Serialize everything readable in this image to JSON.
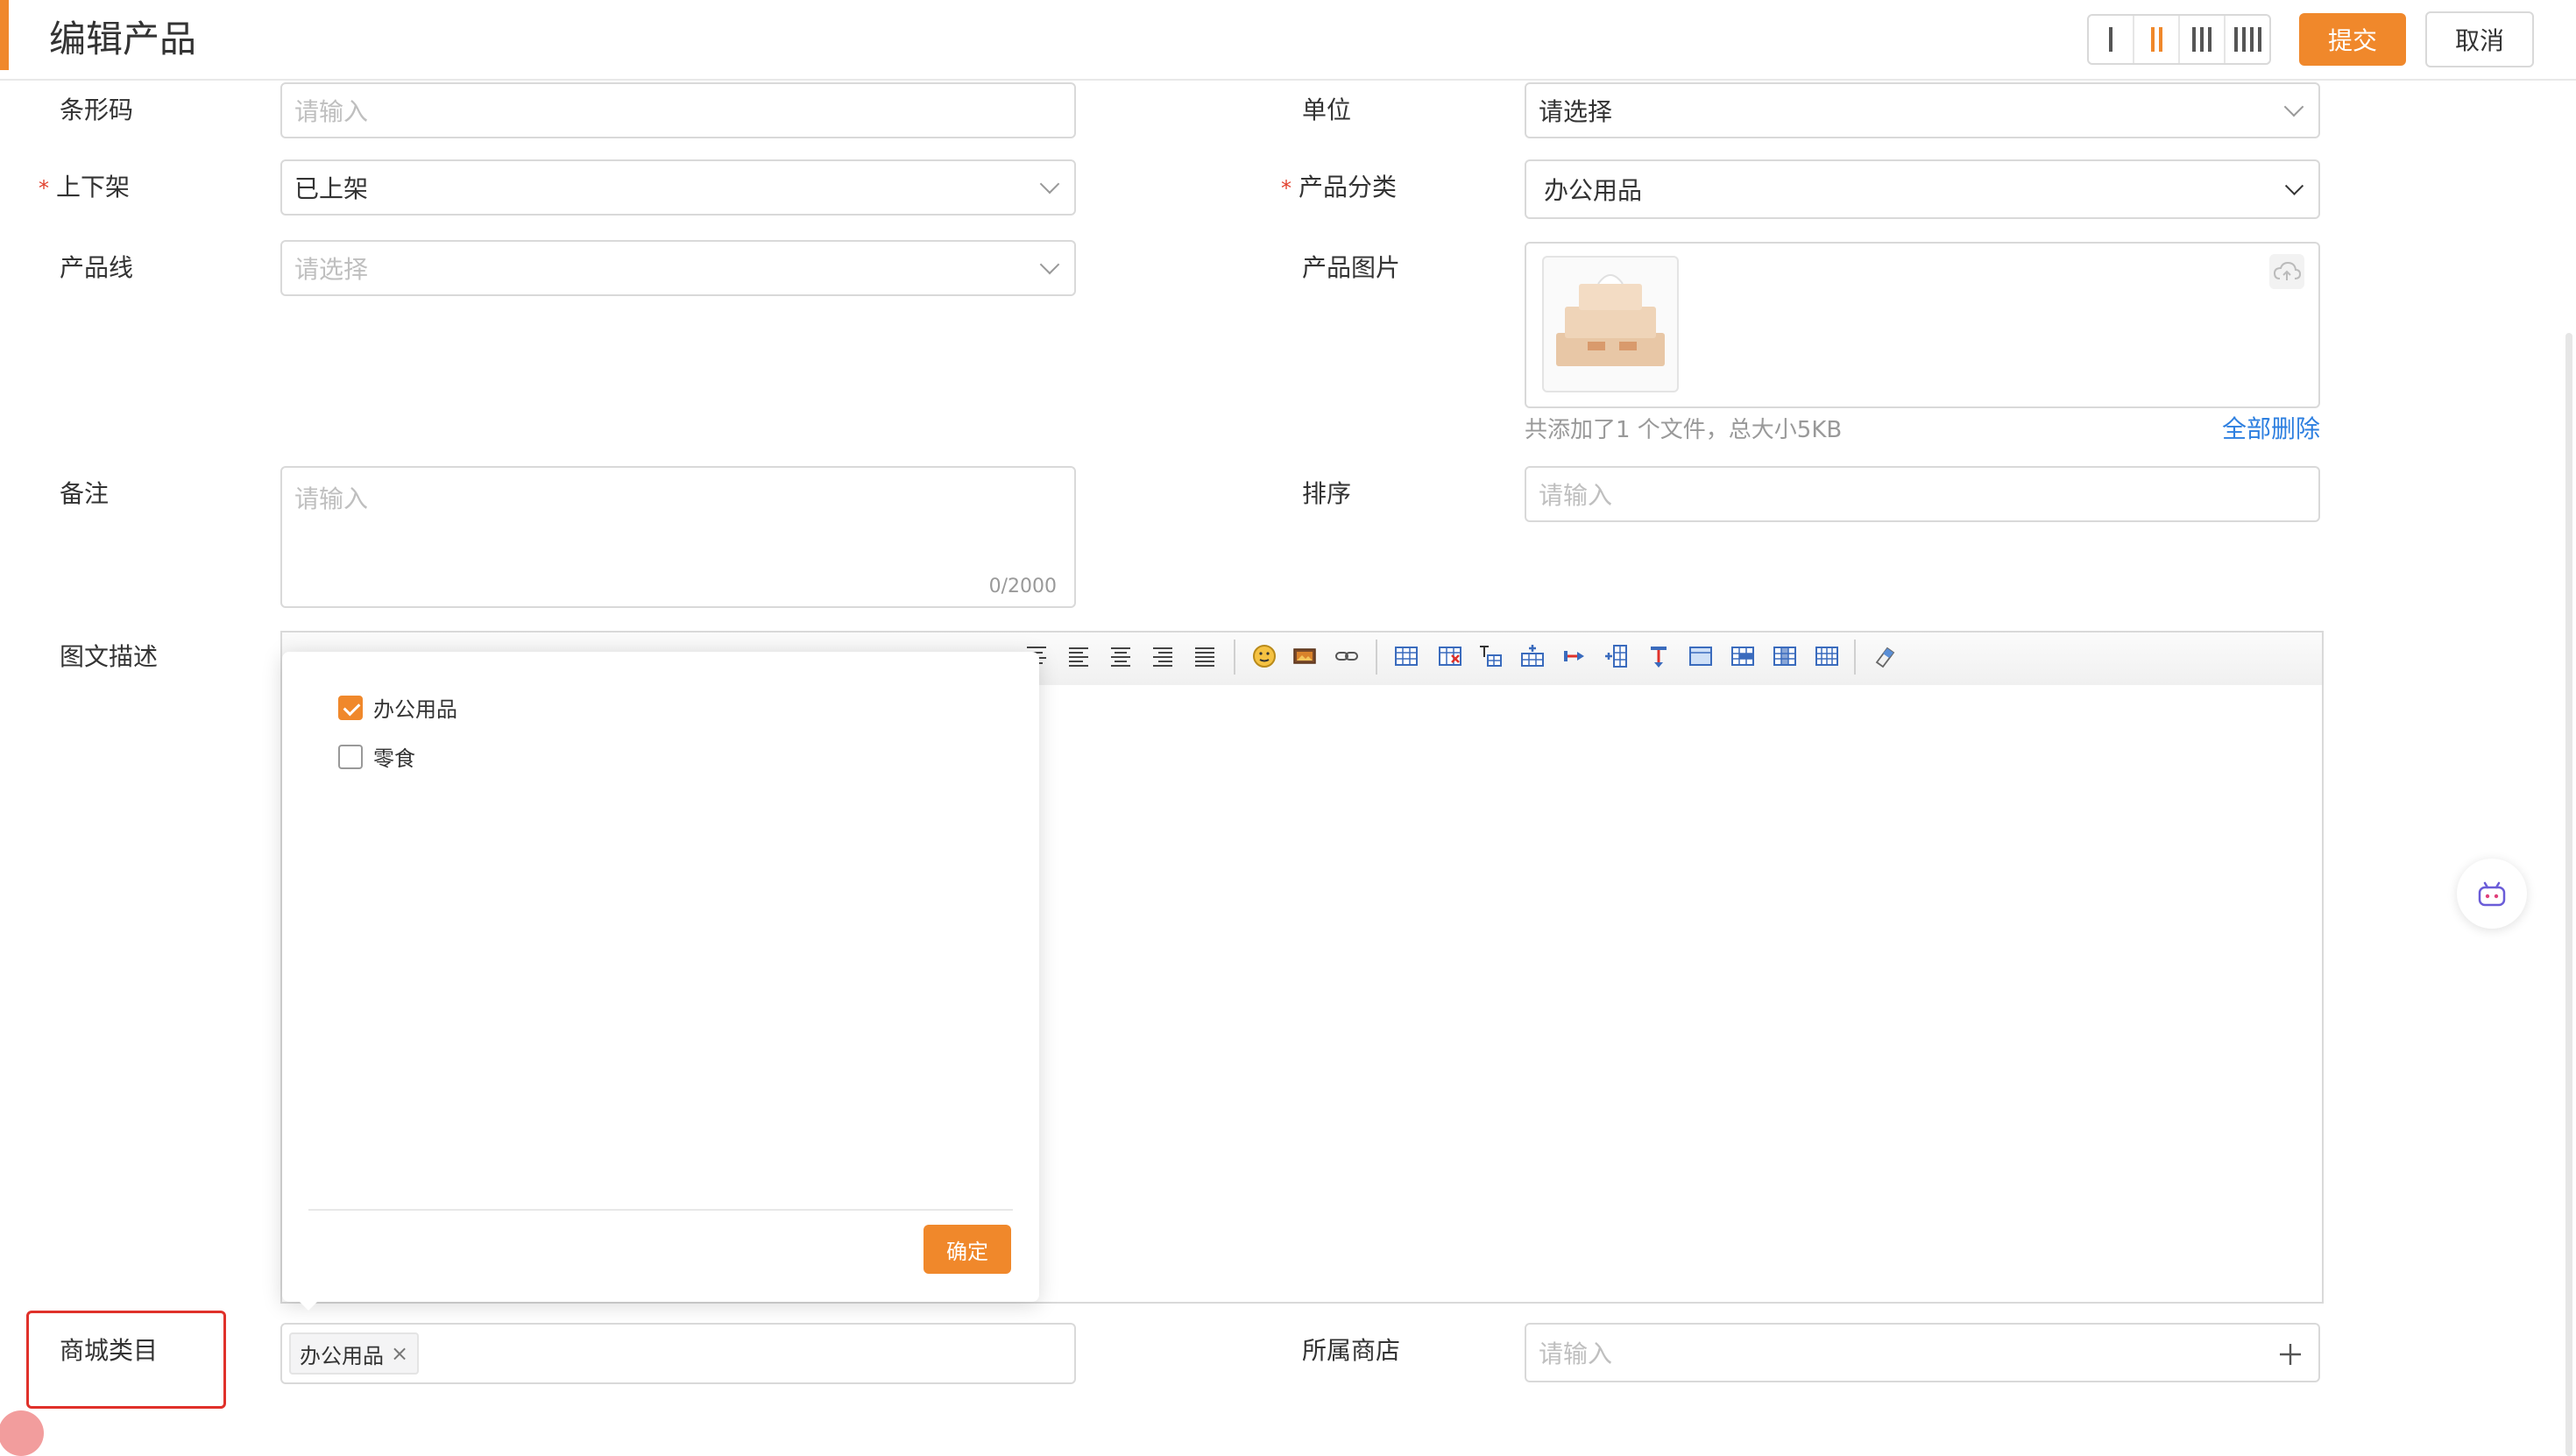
{
  "header": {
    "title": "编辑产品",
    "submit_label": "提交",
    "cancel_label": "取消",
    "layout_options": [
      "1-column",
      "2-column",
      "3-column",
      "4-column"
    ],
    "layout_selected": "2-column",
    "accent_color": "#f0882b"
  },
  "form": {
    "barcode": {
      "label": "条形码",
      "placeholder": "请输入"
    },
    "unit": {
      "label": "单位",
      "value": "请选择"
    },
    "shelf": {
      "label": "上下架",
      "value": "已上架",
      "required": true
    },
    "category": {
      "label": "产品分类",
      "value": "办公用品",
      "required": true
    },
    "product_line": {
      "label": "产品线",
      "placeholder": "请选择"
    },
    "image": {
      "label": "产品图片",
      "summary": "共添加了1 个文件，总大小5KB",
      "delete_all": "全部删除"
    },
    "remark": {
      "label": "备注",
      "placeholder": "请输入",
      "counter": "0/2000"
    },
    "sort": {
      "label": "排序",
      "placeholder": "请输入"
    },
    "description": {
      "label": "图文描述"
    },
    "mall_category": {
      "label": "商城类目",
      "tags": [
        "办公用品"
      ]
    },
    "shop": {
      "label": "所属商店",
      "placeholder": "请输入"
    }
  },
  "dropdown": {
    "options": [
      {
        "label": "办公用品",
        "checked": true
      },
      {
        "label": "零食",
        "checked": false
      }
    ],
    "confirm_label": "确定"
  },
  "toolbar_icons": [
    "align-top-icon",
    "align-left-icon",
    "align-center-icon",
    "align-right-icon",
    "align-justify-icon",
    "emoticon-icon",
    "image-icon",
    "link-icon",
    "insert-table-icon",
    "delete-table-icon",
    "table-caption-icon",
    "insert-row-icon",
    "delete-row-icon",
    "insert-column-icon",
    "delete-column-icon",
    "merge-cells-icon",
    "merge-right-icon",
    "merge-down-icon",
    "split-cells-icon",
    "eraser-icon"
  ]
}
